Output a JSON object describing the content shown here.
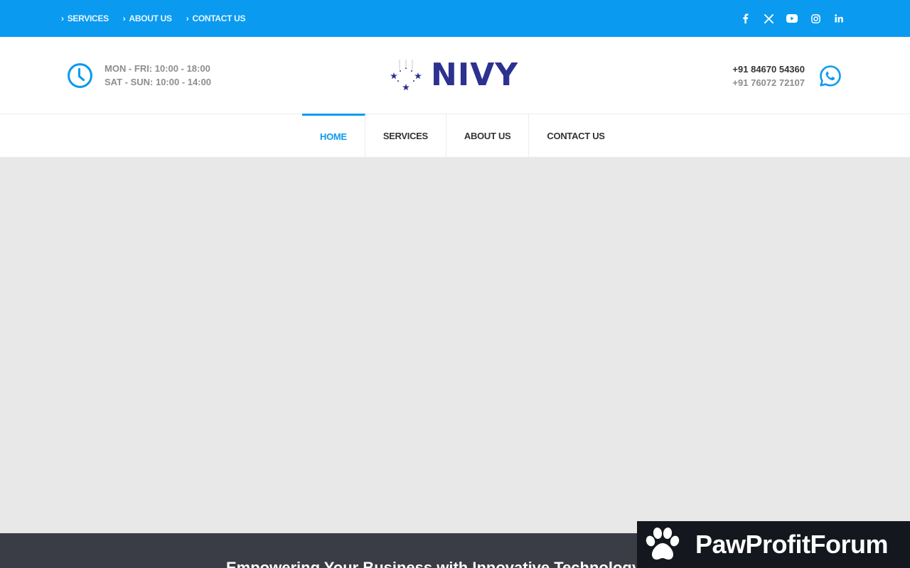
{
  "topbar": {
    "links": [
      "SERVICES",
      "ABOUT US",
      "CONTACT US"
    ],
    "social_icons": [
      "facebook-icon",
      "x-icon",
      "youtube-icon",
      "instagram-icon",
      "linkedin-icon"
    ]
  },
  "header": {
    "hours": {
      "weekdays": "MON - FRI: 10:00 - 18:00",
      "weekend": "SAT - SUN: 10:00 - 14:00"
    },
    "logo_text": "NIVY",
    "phones": {
      "primary": "+91 84670 54360",
      "secondary": "+91 76072 72107"
    }
  },
  "nav": {
    "items": [
      "HOME",
      "SERVICES",
      "ABOUT US",
      "CONTACT US"
    ],
    "active": "HOME"
  },
  "band": {
    "tagline": "Empowering Your Business with Innovative Technology Soluti"
  },
  "badge": {
    "name": "PawProfitForum"
  },
  "colors": {
    "accent": "#0a9bf0",
    "logo": "#2d3190",
    "hero_bg": "#e8e8e9",
    "band_bg": "#3a3c46"
  }
}
